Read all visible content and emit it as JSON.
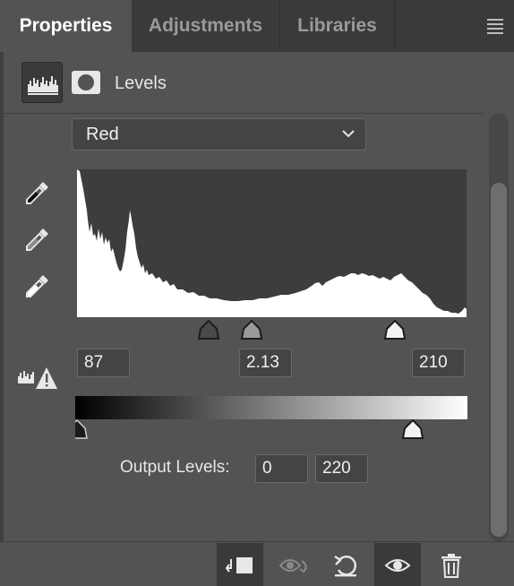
{
  "tabs": [
    {
      "label": "Properties",
      "active": true
    },
    {
      "label": "Adjustments",
      "active": false
    },
    {
      "label": "Libraries",
      "active": false
    }
  ],
  "panel_menu_icon": "hamburger-menu-icon",
  "header": {
    "icon": "levels-histogram-icon",
    "mask_icon": "layer-mask-icon",
    "title": "Levels"
  },
  "channel": {
    "selected": "Red",
    "icon": "chevron-down-icon"
  },
  "eyedroppers": [
    {
      "name": "black-point-eyedropper-icon"
    },
    {
      "name": "gray-point-eyedropper-icon"
    },
    {
      "name": "white-point-eyedropper-icon"
    }
  ],
  "input_levels": {
    "black": "87",
    "gamma": "2.13",
    "white": "210",
    "black_value": 87,
    "white_value": 210
  },
  "output_levels": {
    "label": "Output Levels:",
    "black": "0",
    "white": "220",
    "black_value": 0,
    "white_value": 220
  },
  "clipping_icon": "clipping-warning-icon",
  "footer_icons": [
    "clip-to-layer-icon",
    "view-previous-state-icon",
    "reset-icon",
    "toggle-visibility-icon",
    "delete-icon"
  ],
  "colors": {
    "panel_bg": "#535353",
    "tab_bar_bg": "#3a3a3a",
    "histogram_bg": "#3d3d3d",
    "histogram_fill": "#ffffff",
    "field_bg": "#444444"
  }
}
